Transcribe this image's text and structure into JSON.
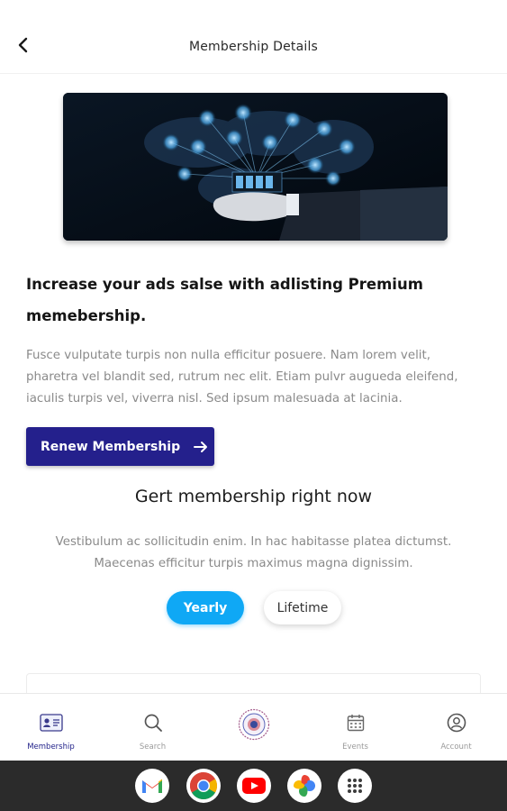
{
  "header": {
    "title": "Membership Details"
  },
  "hero": {
    "image_alt": "network-hand-illustration"
  },
  "content": {
    "headline": "Increase your ads salse with adlisting Premium memebership.",
    "paragraph": "Fusce vulputate turpis non nulla efficitur posuere. Nam lorem velit, pharetra vel blandit sed, rutrum nec elit. Etiam pulvr augueda eleifend, iaculis turpis vel, viverra nisl. Sed ipsum malesuada at lacinia.",
    "renew_label": "Renew Membership"
  },
  "plans": {
    "title": "Gert membership right now",
    "subtitle": "Vestibulum ac sollicitudin enim. In hac habitasse platea dictumst. Maecenas efficitur turpis maximus magna dignissim.",
    "toggle_yearly": "Yearly",
    "toggle_lifetime": "Lifetime",
    "selected": "Yearly"
  },
  "bottom_nav": {
    "items": [
      {
        "label": "Membership",
        "icon": "membership-card-icon",
        "active": true
      },
      {
        "label": "Search",
        "icon": "search-icon",
        "active": false
      },
      {
        "label": "",
        "icon": "logo-emblem",
        "active": false
      },
      {
        "label": "Events",
        "icon": "calendar-icon",
        "active": false
      },
      {
        "label": "Account",
        "icon": "account-icon",
        "active": false
      }
    ]
  },
  "dock": {
    "apps": [
      "gmail-icon",
      "chrome-icon",
      "youtube-icon",
      "photos-icon",
      "app-drawer-icon"
    ]
  },
  "colors": {
    "primary": "#24208c",
    "accent": "#0fa8f5",
    "muted_text": "#8a8a8a",
    "system_bar": "#2b2b2b"
  }
}
